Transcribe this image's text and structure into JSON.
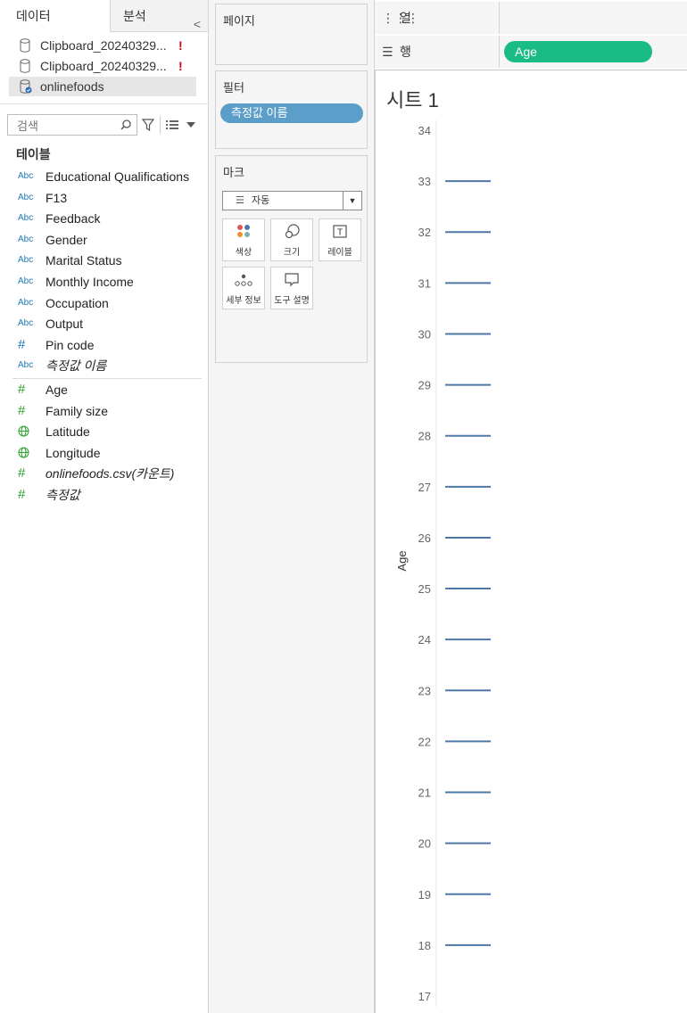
{
  "left": {
    "tabs": {
      "data": "데이터",
      "analysis": "분석"
    },
    "collapse": "<",
    "datasources": [
      {
        "name": "Clipboard_20240329...",
        "warning": "!"
      },
      {
        "name": "Clipboard_20240329...",
        "warning": "!"
      },
      {
        "name": "onlinefoods",
        "warning": ""
      }
    ],
    "search": {
      "placeholder": "검색"
    },
    "table_header": "테이블",
    "dimensions": [
      {
        "icon": "Abc",
        "label": "Educational Qualifications"
      },
      {
        "icon": "Abc",
        "label": "F13"
      },
      {
        "icon": "Abc",
        "label": "Feedback"
      },
      {
        "icon": "Abc",
        "label": "Gender"
      },
      {
        "icon": "Abc",
        "label": "Marital Status"
      },
      {
        "icon": "Abc",
        "label": "Monthly Income"
      },
      {
        "icon": "Abc",
        "label": "Occupation"
      },
      {
        "icon": "Abc",
        "label": "Output"
      },
      {
        "icon": "#",
        "label": "Pin code"
      },
      {
        "icon": "Abc",
        "label": "측정값 이름"
      }
    ],
    "measures": [
      {
        "icon": "#",
        "label": "Age"
      },
      {
        "icon": "#",
        "label": "Family size"
      },
      {
        "icon": "globe",
        "label": "Latitude"
      },
      {
        "icon": "globe",
        "label": "Longitude"
      },
      {
        "icon": "#",
        "label": "onlinefoods.csv(카운트)"
      },
      {
        "icon": "#",
        "label": "측정값"
      }
    ]
  },
  "mid": {
    "pages_title": "페이지",
    "filters_title": "필터",
    "filter_pill": "측정값 이름",
    "marks_title": "마크",
    "mark_type": "자동",
    "mark_buttons": {
      "color": "색상",
      "size": "크기",
      "label": "레이블",
      "detail": "세부 정보",
      "tooltip": "도구 설명"
    }
  },
  "right": {
    "columns_label": "열",
    "rows_label": "행",
    "rows_pill": "Age",
    "sheet_title": "시트 1"
  },
  "colors": {
    "accent_green": "#1abb85",
    "filter_blue": "#5b9ec9",
    "line_blue": "#4e79a7"
  },
  "chart_data": {
    "type": "line",
    "ylabel": "Age",
    "ylim": [
      17,
      34
    ],
    "yticks": [
      17,
      18,
      19,
      20,
      21,
      22,
      23,
      24,
      25,
      26,
      27,
      28,
      29,
      30,
      31,
      32,
      33,
      34
    ],
    "marks": [
      18,
      19,
      20,
      21,
      22,
      23,
      24,
      25,
      26,
      27,
      28,
      29,
      30,
      31,
      32,
      33
    ]
  }
}
